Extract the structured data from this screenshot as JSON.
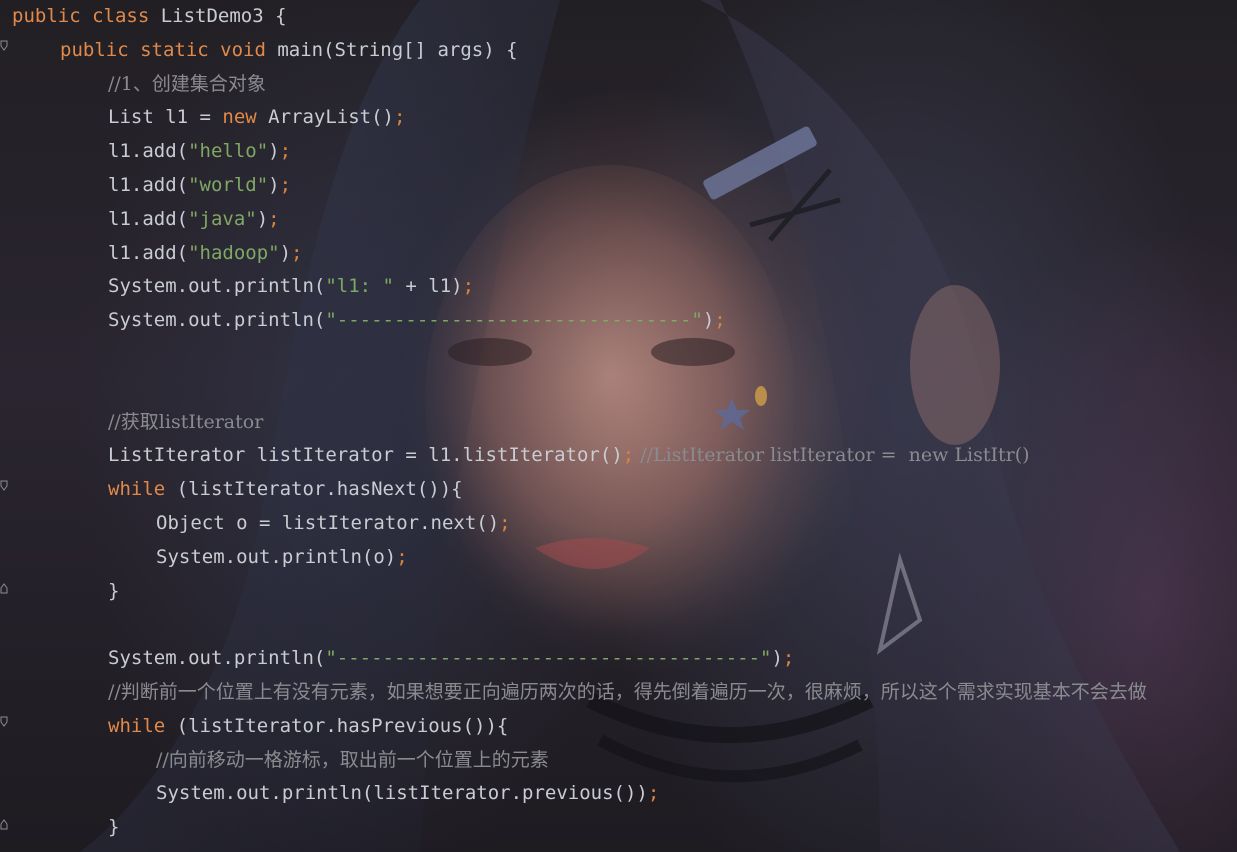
{
  "code_lines": [
    {
      "parts": [
        {
          "t": "public class",
          "c": "kw"
        },
        {
          "t": " ListDemo3 {",
          "c": "ident"
        }
      ]
    },
    {
      "parts": [
        {
          "t": "public static void",
          "c": "kw"
        },
        {
          "t": " main(String[] args) {",
          "c": "ident"
        }
      ]
    },
    {
      "parts": [
        {
          "t": "//1、创建集合对象",
          "c": "cmt"
        }
      ]
    },
    {
      "parts": [
        {
          "t": "List l1 = ",
          "c": "ident"
        },
        {
          "t": "new",
          "c": "kw"
        },
        {
          "t": " ArrayList()",
          "c": "ident"
        },
        {
          "t": ";",
          "c": "semi"
        }
      ]
    },
    {
      "parts": [
        {
          "t": "l1.add(",
          "c": "ident"
        },
        {
          "t": "\"hello\"",
          "c": "str"
        },
        {
          "t": ")",
          "c": "ident"
        },
        {
          "t": ";",
          "c": "semi"
        }
      ]
    },
    {
      "parts": [
        {
          "t": "l1.add(",
          "c": "ident"
        },
        {
          "t": "\"world\"",
          "c": "str"
        },
        {
          "t": ")",
          "c": "ident"
        },
        {
          "t": ";",
          "c": "semi"
        }
      ]
    },
    {
      "parts": [
        {
          "t": "l1.add(",
          "c": "ident"
        },
        {
          "t": "\"java\"",
          "c": "str"
        },
        {
          "t": ")",
          "c": "ident"
        },
        {
          "t": ";",
          "c": "semi"
        }
      ]
    },
    {
      "parts": [
        {
          "t": "l1.add(",
          "c": "ident"
        },
        {
          "t": "\"hadoop\"",
          "c": "str"
        },
        {
          "t": ")",
          "c": "ident"
        },
        {
          "t": ";",
          "c": "semi"
        }
      ]
    },
    {
      "parts": [
        {
          "t": "System.out.println(",
          "c": "ident"
        },
        {
          "t": "\"l1: \"",
          "c": "str"
        },
        {
          "t": " + l1)",
          "c": "ident"
        },
        {
          "t": ";",
          "c": "semi"
        }
      ]
    },
    {
      "parts": [
        {
          "t": "System.out.println(",
          "c": "ident"
        },
        {
          "t": "\"-------------------------------\"",
          "c": "str"
        },
        {
          "t": ")",
          "c": "ident"
        },
        {
          "t": ";",
          "c": "semi"
        }
      ]
    },
    {
      "parts": []
    },
    {
      "parts": []
    },
    {
      "parts": [
        {
          "t": "//获取listIterator",
          "c": "cmt"
        }
      ]
    },
    {
      "parts": [
        {
          "t": "ListIterator listIterator = l1.listIterator()",
          "c": "ident"
        },
        {
          "t": ";",
          "c": "semi"
        },
        {
          "t": " //ListIterator listIterator =  new ListItr()",
          "c": "cmt"
        }
      ]
    },
    {
      "parts": [
        {
          "t": "while",
          "c": "kw"
        },
        {
          "t": " (listIterator.hasNext()){",
          "c": "ident"
        }
      ]
    },
    {
      "parts": [
        {
          "t": "Object o = listIterator.next()",
          "c": "ident"
        },
        {
          "t": ";",
          "c": "semi"
        }
      ]
    },
    {
      "parts": [
        {
          "t": "System.out.println(o)",
          "c": "ident"
        },
        {
          "t": ";",
          "c": "semi"
        }
      ]
    },
    {
      "parts": [
        {
          "t": "}",
          "c": "ident"
        }
      ]
    },
    {
      "parts": []
    },
    {
      "parts": [
        {
          "t": "System.out.println(",
          "c": "ident"
        },
        {
          "t": "\"-------------------------------------\"",
          "c": "str"
        },
        {
          "t": ")",
          "c": "ident"
        },
        {
          "t": ";",
          "c": "semi"
        }
      ]
    },
    {
      "parts": [
        {
          "t": "//判断前一个位置上有没有元素，如果想要正向遍历两次的话，得先倒着遍历一次，很麻烦，所以这个需求实现基本不会去做",
          "c": "cmt"
        }
      ]
    },
    {
      "parts": [
        {
          "t": "while",
          "c": "kw"
        },
        {
          "t": " (listIterator.hasPrevious()){",
          "c": "ident"
        }
      ]
    },
    {
      "parts": [
        {
          "t": "//向前移动一格游标，取出前一个位置上的元素",
          "c": "cmt"
        }
      ]
    },
    {
      "parts": [
        {
          "t": "System.out.println(listIterator.previous())",
          "c": "ident"
        },
        {
          "t": ";",
          "c": "semi"
        }
      ]
    },
    {
      "parts": [
        {
          "t": "}",
          "c": "ident"
        }
      ]
    }
  ],
  "colors": {
    "keyword": "#e0894a",
    "string": "#7fa863",
    "comment": "#8a8b90",
    "identifier": "#c9ccd2",
    "semicolon": "#d9843f"
  }
}
